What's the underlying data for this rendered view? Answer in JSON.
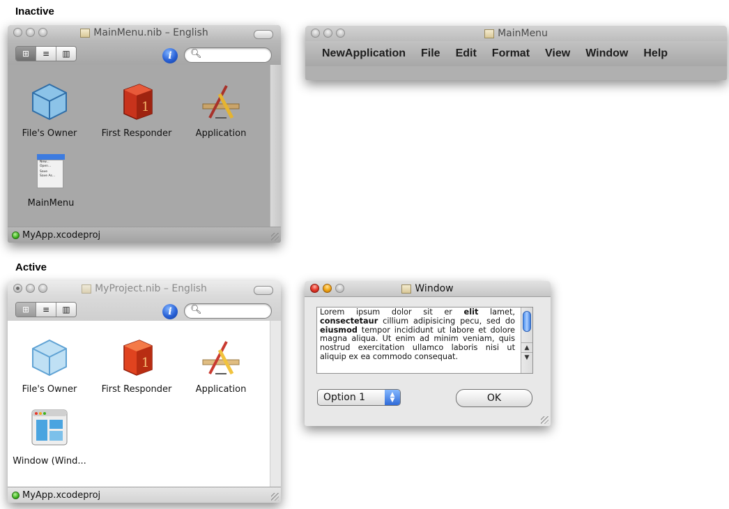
{
  "labels": {
    "inactive": "Inactive",
    "active": "Active"
  },
  "inactive_doc": {
    "title": "MainMenu.nib – English",
    "objects": [
      "File's Owner",
      "First Responder",
      "Application",
      "MainMenu"
    ],
    "menu_icon_lines": [
      "New...",
      "Open...",
      "Save",
      "Save As..."
    ],
    "status": "MyApp.xcodeproj",
    "info_glyph": "i",
    "view_modes": [
      "⊞",
      "≡",
      "▥"
    ]
  },
  "menubar_window": {
    "title": "MainMenu",
    "items": [
      "NewApplication",
      "File",
      "Edit",
      "Format",
      "View",
      "Window",
      "Help"
    ]
  },
  "active_doc": {
    "title": "MyProject.nib – English",
    "objects": [
      "File's Owner",
      "First Responder",
      "Application",
      "Window (Wind..."
    ],
    "status": "MyApp.xcodeproj",
    "info_glyph": "i",
    "view_modes": [
      "⊞",
      "≡",
      "▥"
    ]
  },
  "window_preview": {
    "title": "Window",
    "text_segments": [
      {
        "t": "Lorem ipsum dolor sit er ",
        "b": false
      },
      {
        "t": "elit",
        "b": true
      },
      {
        "t": " lamet, ",
        "b": false
      },
      {
        "t": "consectetaur",
        "b": true
      },
      {
        "t": " cillium adipisicing pecu, sed do ",
        "b": false
      },
      {
        "t": "eiusmod",
        "b": true
      },
      {
        "t": " tempor incididunt ut labore et dolore magna aliqua. Ut enim ad minim veniam, quis nostrud exercitation ullamco laboris nisi ut aliquip ex ea commodo consequat.",
        "b": false
      }
    ],
    "popup_value": "Option 1",
    "ok_label": "OK"
  },
  "colors": {
    "inactive_chrome": "#b5b5b5",
    "inactive_pane": "#a8a8a8",
    "active_chrome": "#e3e3e3",
    "active_pane": "#ffffff",
    "accent_blue": "#2961d6"
  }
}
